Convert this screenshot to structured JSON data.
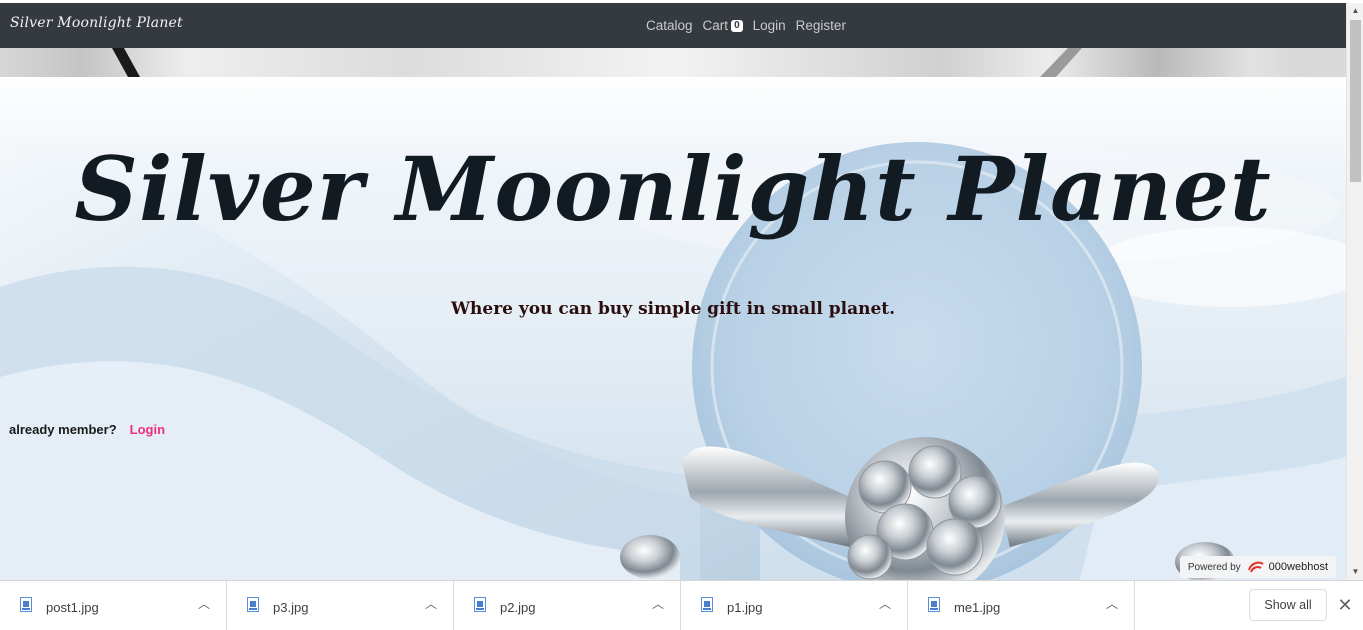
{
  "navbar": {
    "brand": "Silver Moonlight Planet",
    "links": {
      "catalog": "Catalog",
      "cart": "Cart",
      "cart_count": "0",
      "login": "Login",
      "register": "Register"
    }
  },
  "hero": {
    "title": "Silver Moonlight Planet",
    "subtitle": "Where you can buy simple gift in small planet.",
    "member_prompt": "already member?",
    "member_login": "Login"
  },
  "powered_by": {
    "label": "Powered by",
    "name": "000webhost"
  },
  "downloads": {
    "items": [
      {
        "name": "post1.jpg"
      },
      {
        "name": "p3.jpg"
      },
      {
        "name": "p2.jpg"
      },
      {
        "name": "p1.jpg"
      },
      {
        "name": "me1.jpg"
      }
    ],
    "show_all": "Show all"
  },
  "icons": {
    "cart_badge": "badge",
    "download_file": "image-file-icon",
    "chevron": "chevron-up-icon",
    "close": "close-icon"
  },
  "colors": {
    "navbar_bg": "#343a40",
    "accent_login": "#ee2f7d",
    "title_color": "#121a22"
  }
}
